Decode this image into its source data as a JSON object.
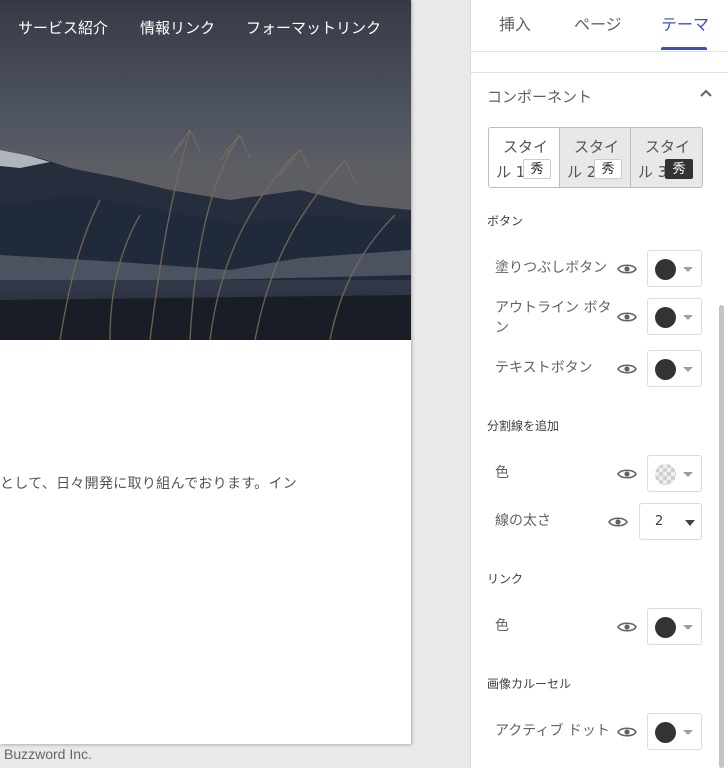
{
  "site": {
    "nav": [
      "サービス紹介",
      "情報リンク",
      "フォーマットリンク"
    ],
    "body_text": "として、日々開発に取り組んでおります。イン",
    "footer": "Buzzword Inc."
  },
  "panel": {
    "tabs": [
      "挿入",
      "ページ",
      "テーマ"
    ],
    "active_tab": "テーマ",
    "section_title": "コンポーネント",
    "styles": [
      {
        "line1": "スタイ",
        "line2": "ル 1",
        "badge": "秀"
      },
      {
        "line1": "スタイ",
        "line2": "ル 2",
        "badge": "秀"
      },
      {
        "line1": "スタイ",
        "line2": "ル 3",
        "badge": "秀"
      }
    ],
    "button_group": {
      "label": "ボタン",
      "rows": [
        {
          "label": "塗りつぶしボタン"
        },
        {
          "label": "アウトライン ボタン"
        },
        {
          "label": "テキストボタン"
        }
      ]
    },
    "divider_group": {
      "label": "分割線を追加",
      "color_label": "色",
      "thickness_label": "線の太さ",
      "thickness_value": "2"
    },
    "link_group": {
      "label": "リンク",
      "color_label": "色"
    },
    "carousel_group": {
      "label": "画像カルーセル",
      "active_dot_label": "アクティブ ドット"
    }
  },
  "colors": {
    "accent": "#3f51b5",
    "swatch": "#333333",
    "selected_style_bg": "#e8e8e8"
  }
}
